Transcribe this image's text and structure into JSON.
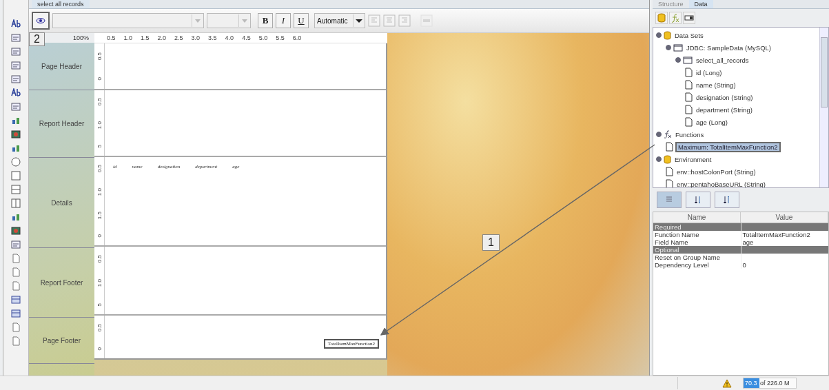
{
  "document_tab": {
    "title": "select all records",
    "selected": true
  },
  "toolbar": {
    "bold": "B",
    "italic": "I",
    "underline": "U",
    "color_label": "Automatic"
  },
  "ruler": {
    "zoom": "100%",
    "ticks": [
      "0.5",
      "1.0",
      "1.5",
      "2.0",
      "2.5",
      "3.0",
      "3.5",
      "4.0",
      "4.5",
      "5.0",
      "5.5",
      "6.0"
    ]
  },
  "bands": [
    {
      "label": "Page Header",
      "ruler": [
        "0.5",
        "0"
      ]
    },
    {
      "label": "Report Header",
      "ruler": [
        "0.5",
        "1.0",
        "5"
      ]
    },
    {
      "label": "Details",
      "ruler": [
        "0.5",
        "1.0",
        "1.5",
        "0"
      ],
      "fields": [
        "id",
        "name",
        "designation",
        "department",
        "age"
      ]
    },
    {
      "label": "Report Footer",
      "ruler": [
        "0.5",
        "1.0",
        "5"
      ]
    },
    {
      "label": "Page Footer",
      "ruler": [
        "0.5",
        "0"
      ],
      "boxed_field": "TotalItemMaxFunction2"
    }
  ],
  "callouts": [
    "1",
    "2"
  ],
  "right_tabs": [
    {
      "label": "Structure",
      "selected": false
    },
    {
      "label": "Data",
      "selected": true
    }
  ],
  "tree": [
    {
      "label": "Data Sets",
      "kind": "datasets",
      "expanded": true,
      "selected": false,
      "children": [
        {
          "label": "JDBC: SampleData (MySQL)",
          "kind": "connection",
          "expanded": true,
          "selected": false,
          "children": [
            {
              "label": "select_all_records",
              "kind": "query",
              "expanded": true,
              "selected": false,
              "children": [
                {
                  "label": "id (Long)",
                  "kind": "field",
                  "selected": false
                },
                {
                  "label": "name (String)",
                  "kind": "field",
                  "selected": false
                },
                {
                  "label": "designation (String)",
                  "kind": "field",
                  "selected": false
                },
                {
                  "label": "department (String)",
                  "kind": "field",
                  "selected": false
                },
                {
                  "label": "age (Long)",
                  "kind": "field",
                  "selected": false
                }
              ]
            }
          ]
        }
      ]
    },
    {
      "label": "Functions",
      "kind": "functions",
      "expanded": true,
      "selected": false,
      "children": [
        {
          "label": "Maximum: TotalItemMaxFunction2",
          "kind": "field",
          "selected": true
        }
      ]
    },
    {
      "label": "Environment",
      "kind": "datasets",
      "expanded": true,
      "selected": false,
      "children": [
        {
          "label": "env::hostColonPort (String)",
          "kind": "field",
          "selected": false
        },
        {
          "label": "env::pentahoBaseURL (String)",
          "kind": "field",
          "selected": false
        }
      ]
    }
  ],
  "properties": {
    "columns": [
      "Name",
      "Value"
    ],
    "rows": [
      {
        "kind": "group",
        "name": "Required"
      },
      {
        "kind": "property",
        "name": "Function Name",
        "value": "TotalItemMaxFunction2"
      },
      {
        "kind": "property",
        "name": "Field Name",
        "value": "age"
      },
      {
        "kind": "group",
        "name": "Optional"
      },
      {
        "kind": "property",
        "name": "Reset on Group Name"
      },
      {
        "kind": "property",
        "name": "Dependency Level",
        "value": "0"
      }
    ]
  },
  "status_bar": {
    "memory_used": "70.3",
    "memory_total": "of 226.0 M",
    "level": 0.3
  }
}
